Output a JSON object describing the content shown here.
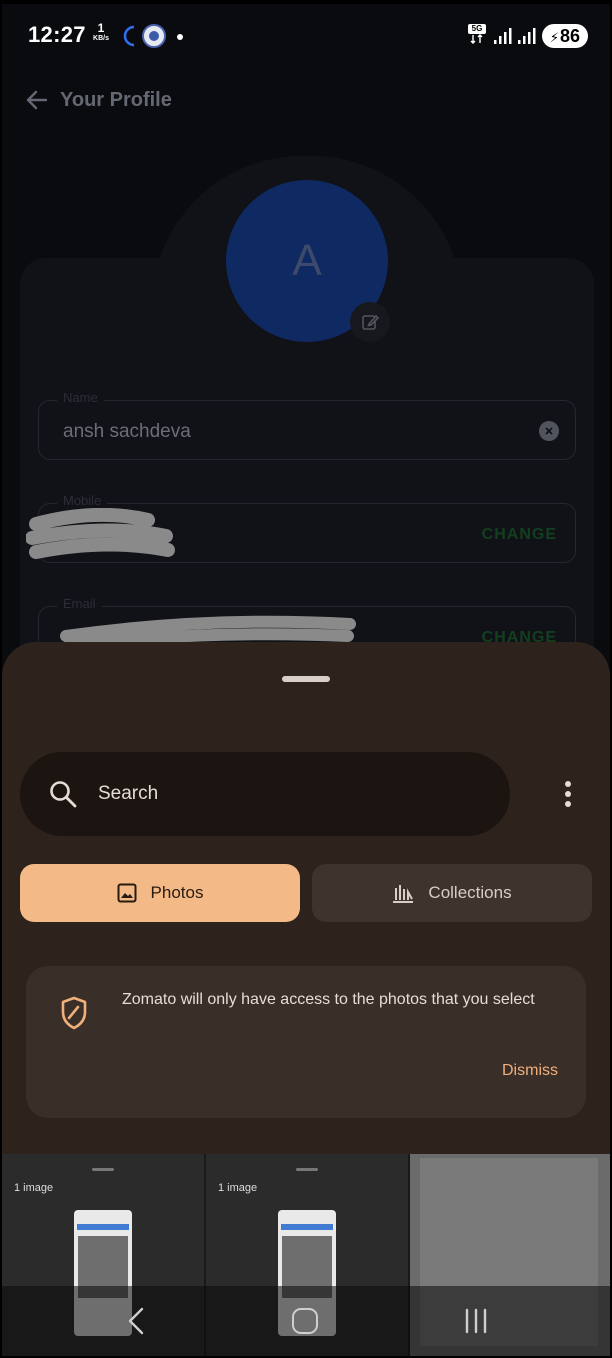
{
  "status_bar": {
    "time": "12:27",
    "speed_value": "1",
    "speed_unit": "KB/s",
    "network_badge": "5G",
    "battery": "86"
  },
  "profile": {
    "title": "Your Profile",
    "avatar_letter": "A",
    "name_label": "Name",
    "name_value": "ansh sachdeva",
    "mobile_label": "Mobile",
    "email_label": "Email",
    "change_label": "CHANGE"
  },
  "sheet": {
    "search_placeholder": "Search",
    "tabs": [
      {
        "label": "Photos",
        "active": true
      },
      {
        "label": "Collections",
        "active": false
      }
    ],
    "notice_text": "Zomato will only have access to the photos that you select",
    "dismiss_label": "Dismiss"
  },
  "grid": {
    "items": [
      {
        "label": "1 image"
      },
      {
        "label": "1 image"
      }
    ]
  },
  "colors": {
    "sheet_bg": "#2e231c",
    "active_tab": "#f3b986",
    "accent": "#f0b07c",
    "avatar_bg": "#0f2962"
  }
}
